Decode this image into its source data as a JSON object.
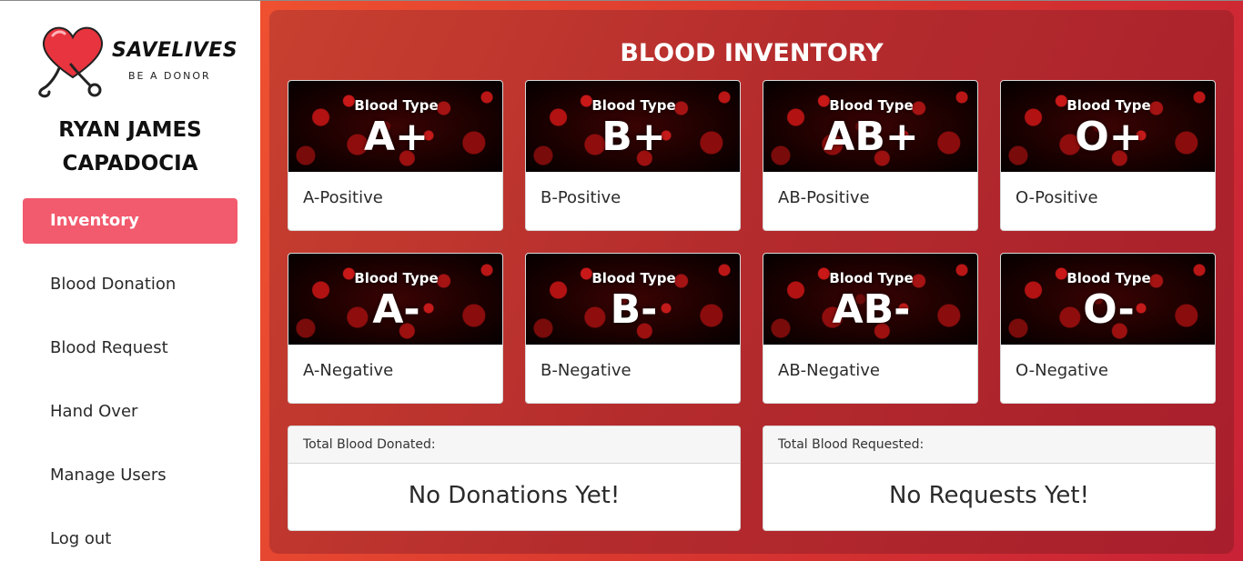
{
  "brand": {
    "name": "SAVELIVES",
    "tagline": "BE A DONOR"
  },
  "user": {
    "first_line": "RYAN JAMES",
    "second_line": "CAPADOCIA"
  },
  "nav": [
    {
      "label": "Inventory",
      "active": true
    },
    {
      "label": "Blood Donation",
      "active": false
    },
    {
      "label": "Blood Request",
      "active": false
    },
    {
      "label": "Hand Over",
      "active": false
    },
    {
      "label": "Manage Users",
      "active": false
    },
    {
      "label": "Log out",
      "active": false
    }
  ],
  "inventory": {
    "title": "BLOOD INVENTORY",
    "image_caption": "Blood Type",
    "cards": [
      {
        "type": "A+",
        "label": "A-Positive"
      },
      {
        "type": "B+",
        "label": "B-Positive"
      },
      {
        "type": "AB+",
        "label": "AB-Positive"
      },
      {
        "type": "O+",
        "label": "O-Positive"
      },
      {
        "type": "A-",
        "label": "A-Negative"
      },
      {
        "type": "B-",
        "label": "B-Negative"
      },
      {
        "type": "AB-",
        "label": "AB-Negative"
      },
      {
        "type": "O-",
        "label": "O-Negative"
      }
    ]
  },
  "totals": {
    "donated": {
      "header": "Total Blood Donated:",
      "value": "No Donations Yet!"
    },
    "requested": {
      "header": "Total Blood Requested:",
      "value": "No Requests Yet!"
    }
  },
  "colors": {
    "accent": "#f25a6d",
    "panel": "#b52c2d",
    "heart": "#e8343e"
  }
}
